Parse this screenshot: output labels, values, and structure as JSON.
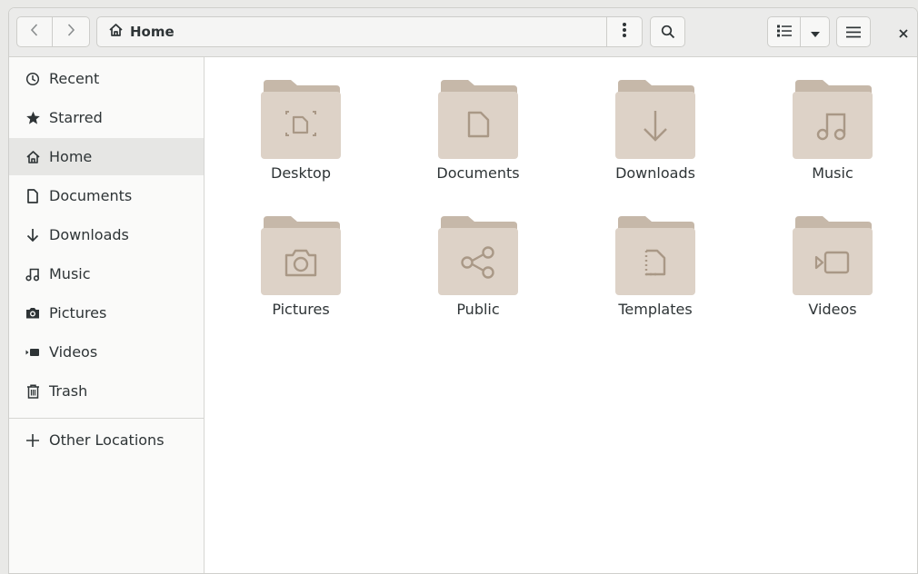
{
  "window": {
    "location": "Home"
  },
  "header": {
    "back_icon": "chevron-left-icon",
    "forward_icon": "chevron-right-icon",
    "path_icon": "home-icon",
    "path_label": "Home",
    "path_menu_icon": "vertical-dots-icon",
    "search_icon": "search-icon",
    "view_icon": "list-view-icon",
    "view_dropdown_icon": "caret-down-icon",
    "menu_icon": "hamburger-icon",
    "close_icon": "close-icon"
  },
  "sidebar": {
    "items": [
      {
        "label": "Recent",
        "icon": "clock-icon"
      },
      {
        "label": "Starred",
        "icon": "star-icon"
      },
      {
        "label": "Home",
        "icon": "home-icon",
        "active": true
      },
      {
        "label": "Documents",
        "icon": "document-icon"
      },
      {
        "label": "Downloads",
        "icon": "download-arrow-icon"
      },
      {
        "label": "Music",
        "icon": "music-note-icon"
      },
      {
        "label": "Pictures",
        "icon": "camera-icon"
      },
      {
        "label": "Videos",
        "icon": "video-icon"
      },
      {
        "label": "Trash",
        "icon": "trash-icon"
      }
    ],
    "other_locations": {
      "label": "Other Locations",
      "icon": "plus-icon"
    }
  },
  "content": {
    "folders": [
      {
        "name": "Desktop",
        "icon": "desktop-folder-icon"
      },
      {
        "name": "Documents",
        "icon": "documents-folder-icon"
      },
      {
        "name": "Downloads",
        "icon": "downloads-folder-icon"
      },
      {
        "name": "Music",
        "icon": "music-folder-icon"
      },
      {
        "name": "Pictures",
        "icon": "pictures-folder-icon"
      },
      {
        "name": "Public",
        "icon": "public-folder-icon"
      },
      {
        "name": "Templates",
        "icon": "templates-folder-icon"
      },
      {
        "name": "Videos",
        "icon": "videos-folder-icon"
      }
    ]
  },
  "colors": {
    "folder_back": "#c6b8a9",
    "folder_front": "#ddd2c7",
    "folder_glyph": "#a99886",
    "sidebar_active": "#e6e6e4"
  }
}
